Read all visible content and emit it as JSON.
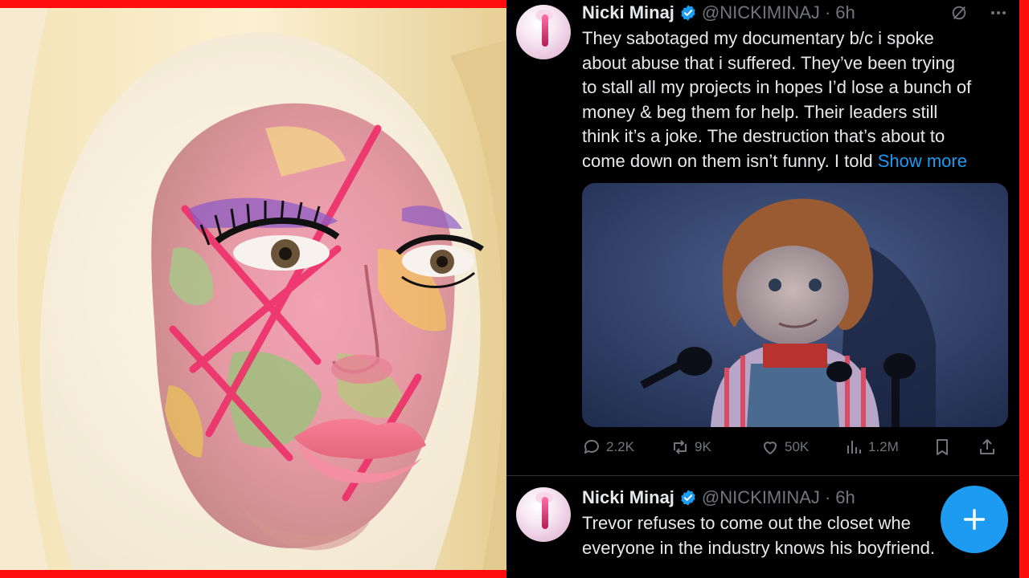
{
  "posts": [
    {
      "author_name": "Nicki Minaj",
      "handle": "@NICKIMINAJ",
      "separator": "·",
      "time": "6h",
      "text_lines": [
        "They sabotaged my documentary b/c i spoke",
        "about abuse that i suffered. They’ve been trying",
        "to stall all my projects in hopes I’d lose a bunch of",
        "money & beg them for help. Their leaders still",
        "think it’s a joke. The destruction that’s about to",
        "come down on them isn’t funny. I told "
      ],
      "show_more": "Show more",
      "stats": {
        "replies": "2.2K",
        "reposts": "9K",
        "likes": "50K",
        "views": "1.2M"
      }
    },
    {
      "author_name": "Nicki Minaj",
      "handle": "@NICKIMINAJ",
      "separator": "·",
      "time": "6h",
      "text_lines": [
        "Trevor refuses to come out the closet whe",
        "everyone in the industry knows his boyfriend."
      ]
    }
  ],
  "icons": {
    "verified": "verified-badge-icon",
    "grok": "grok-icon",
    "more": "more-icon",
    "reply": "reply-icon",
    "repost": "repost-icon",
    "like": "heart-icon",
    "views": "views-icon",
    "bookmark": "bookmark-icon",
    "share": "share-icon",
    "compose": "plus-icon"
  },
  "colors": {
    "frame": "#ff0d0d",
    "accent": "#1d9bf0",
    "text_primary": "#e7e9ea",
    "text_secondary": "#71767b"
  }
}
